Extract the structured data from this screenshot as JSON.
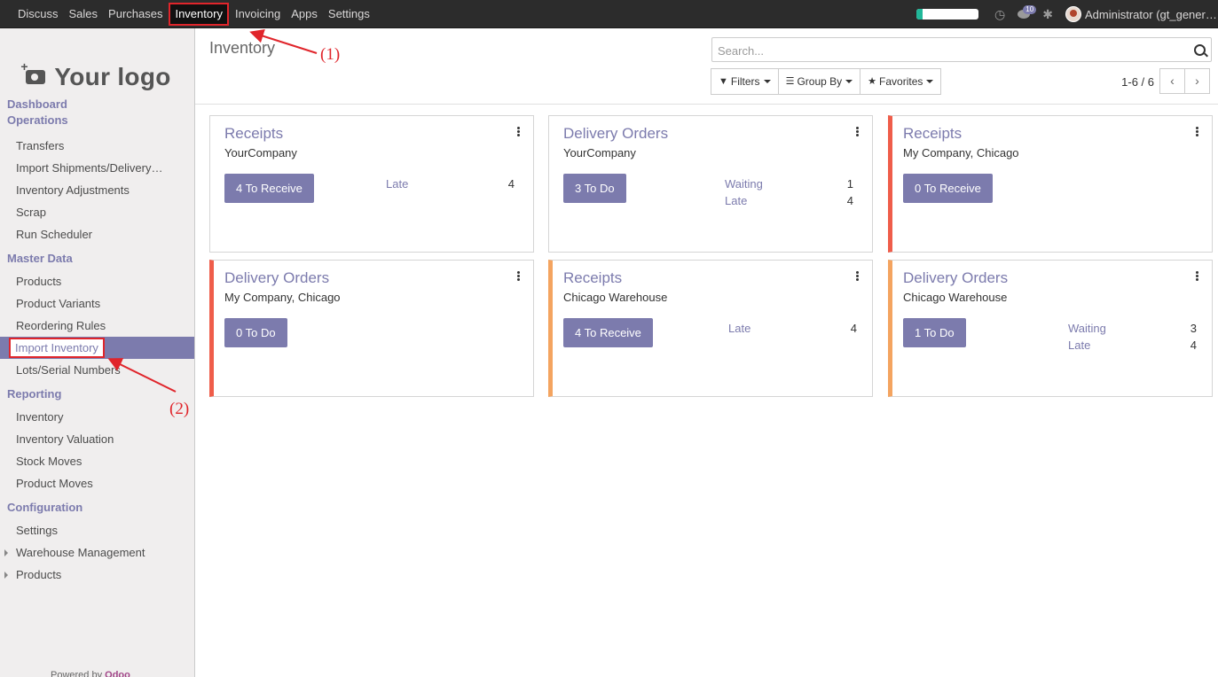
{
  "navbar": {
    "menu": [
      "Discuss",
      "Sales",
      "Purchases",
      "Inventory",
      "Invoicing",
      "Apps",
      "Settings"
    ],
    "active_menu": "Inventory",
    "notification_count": "10",
    "user": "Administrator (gt_gener…",
    "progress_fraction": 0.1
  },
  "sidebar": {
    "logo_text": "Your logo",
    "sections": [
      {
        "title": "Dashboard",
        "items": []
      },
      {
        "title": "Operations",
        "items": [
          "Transfers",
          "Import Shipments/Delivery…",
          "Inventory Adjustments",
          "Scrap",
          "Run Scheduler"
        ]
      },
      {
        "title": "Master Data",
        "items": [
          "Products",
          "Product Variants",
          "Reordering Rules",
          "Import Inventory",
          "Lots/Serial Numbers"
        ]
      },
      {
        "title": "Reporting",
        "items": [
          "Inventory",
          "Inventory Valuation",
          "Stock Moves",
          "Product Moves"
        ]
      },
      {
        "title": "Configuration",
        "items": [
          "Settings",
          "Warehouse Management",
          "Products"
        ]
      }
    ],
    "active_item": "Import Inventory",
    "powered_by": "Powered by",
    "powered_brand": "Odoo"
  },
  "control_panel": {
    "breadcrumb": "Inventory",
    "search_placeholder": "Search...",
    "filters_label": "Filters",
    "groupby_label": "Group By",
    "favorites_label": "Favorites",
    "pager": "1-6 / 6"
  },
  "cards": [
    {
      "title": "Receipts",
      "company": "YourCompany",
      "button": "4 To Receive",
      "stats": [
        {
          "label": "Late",
          "value": "4"
        }
      ],
      "accent": ""
    },
    {
      "title": "Delivery Orders",
      "company": "YourCompany",
      "button": "3 To Do",
      "stats": [
        {
          "label": "Waiting",
          "value": "1"
        },
        {
          "label": "Late",
          "value": "4"
        }
      ],
      "accent": ""
    },
    {
      "title": "Receipts",
      "company": "My Company, Chicago",
      "button": "0 To Receive",
      "stats": [],
      "accent": "#ef5d4a"
    },
    {
      "title": "Delivery Orders",
      "company": "My Company, Chicago",
      "button": "0 To Do",
      "stats": [],
      "accent": "#ef5d4a"
    },
    {
      "title": "Receipts",
      "company": "Chicago Warehouse",
      "button": "4 To Receive",
      "stats": [
        {
          "label": "Late",
          "value": "4"
        }
      ],
      "accent": "#f4a460"
    },
    {
      "title": "Delivery Orders",
      "company": "Chicago Warehouse",
      "button": "1 To Do",
      "stats": [
        {
          "label": "Waiting",
          "value": "3"
        },
        {
          "label": "Late",
          "value": "4"
        }
      ],
      "accent": "#f4a460"
    }
  ],
  "annotations": [
    "(1)",
    "(2)"
  ],
  "colors": {
    "primary": "#7c7bad",
    "navbar": "#2c2c2c",
    "highlight": "#e0252b"
  }
}
